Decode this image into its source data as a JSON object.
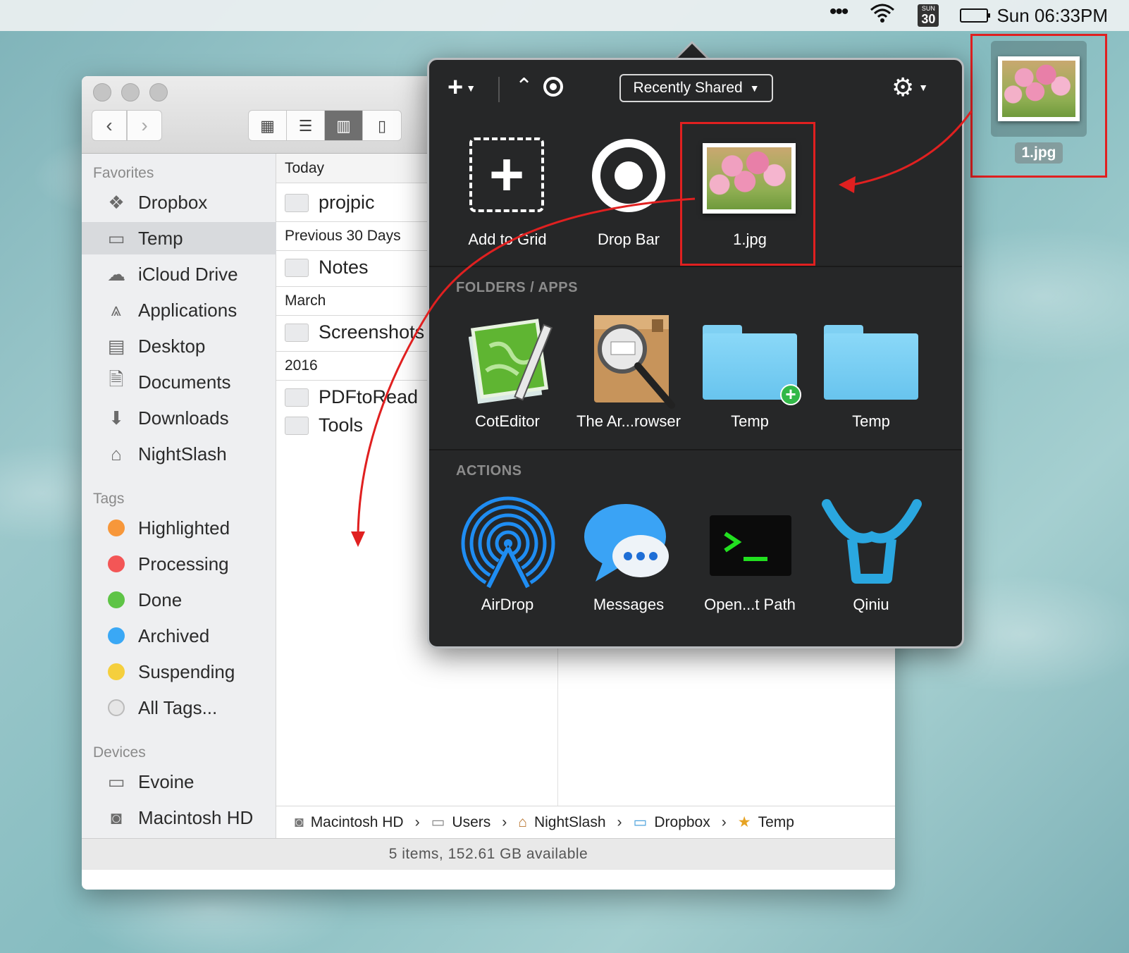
{
  "menubar": {
    "dots": "•••",
    "calendar_day": "SUN",
    "calendar_date": "30",
    "clock": "Sun 06:33PM"
  },
  "desktop": {
    "file_label": "1.jpg"
  },
  "finder": {
    "sidebar": {
      "favorites_heading": "Favorites",
      "favorites": [
        {
          "label": "Dropbox",
          "icon": "dropbox-icon"
        },
        {
          "label": "Temp",
          "icon": "folder-icon"
        },
        {
          "label": "iCloud Drive",
          "icon": "cloud-icon"
        },
        {
          "label": "Applications",
          "icon": "applications-icon"
        },
        {
          "label": "Desktop",
          "icon": "desktop-icon"
        },
        {
          "label": "Documents",
          "icon": "documents-icon"
        },
        {
          "label": "Downloads",
          "icon": "downloads-icon"
        },
        {
          "label": "NightSlash",
          "icon": "home-icon"
        }
      ],
      "tags_heading": "Tags",
      "tags": [
        {
          "label": "Highlighted",
          "color": "#f7973a"
        },
        {
          "label": "Processing",
          "color": "#f35656"
        },
        {
          "label": "Done",
          "color": "#5ec446"
        },
        {
          "label": "Archived",
          "color": "#3aa8f5"
        },
        {
          "label": "Suspending",
          "color": "#f5cf3d"
        },
        {
          "label": "All Tags...",
          "color": "#dcdcdc"
        }
      ],
      "devices_heading": "Devices",
      "devices": [
        {
          "label": "Evoine",
          "icon": "laptop-icon"
        },
        {
          "label": "Macintosh HD",
          "icon": "hard-drive-icon"
        }
      ]
    },
    "column": {
      "groups": [
        {
          "heading": "Today",
          "items": [
            "projpic"
          ]
        },
        {
          "heading": "Previous 30 Days",
          "items": [
            "Notes"
          ]
        },
        {
          "heading": "March",
          "items": [
            "Screenshots"
          ]
        },
        {
          "heading": "2016",
          "items": [
            "PDFtoRead",
            "Tools"
          ]
        }
      ]
    },
    "path": [
      "Macintosh HD",
      "Users",
      "NightSlash",
      "Dropbox",
      "Temp"
    ],
    "status": "5 items, 152.61 GB available"
  },
  "popover": {
    "recent_label": "Recently Shared",
    "grid": [
      {
        "label": "Add to Grid",
        "icon": "add-to-grid-icon"
      },
      {
        "label": "Drop Bar",
        "icon": "drop-bar-icon"
      },
      {
        "label": "1.jpg",
        "icon": "image-thumbnail-icon"
      }
    ],
    "folders_heading": "FOLDERS / APPS",
    "folders": [
      {
        "label": "CotEditor",
        "icon": "coteditor-icon"
      },
      {
        "label": "The Ar...rowser",
        "icon": "archive-browser-icon"
      },
      {
        "label": "Temp",
        "icon": "folder-add-icon"
      },
      {
        "label": "Temp",
        "icon": "folder-icon"
      }
    ],
    "actions_heading": "ACTIONS",
    "actions": [
      {
        "label": "AirDrop",
        "icon": "airdrop-icon"
      },
      {
        "label": "Messages",
        "icon": "messages-icon"
      },
      {
        "label": "Open...t Path",
        "icon": "terminal-icon"
      },
      {
        "label": "Qiniu",
        "icon": "qiniu-icon"
      }
    ]
  },
  "colors": {
    "annotation_red": "#e02020",
    "popover_bg": "#262728",
    "airdrop_blue": "#1f8df2",
    "qiniu_blue": "#2aa7e0",
    "terminal_green": "#22e020"
  }
}
